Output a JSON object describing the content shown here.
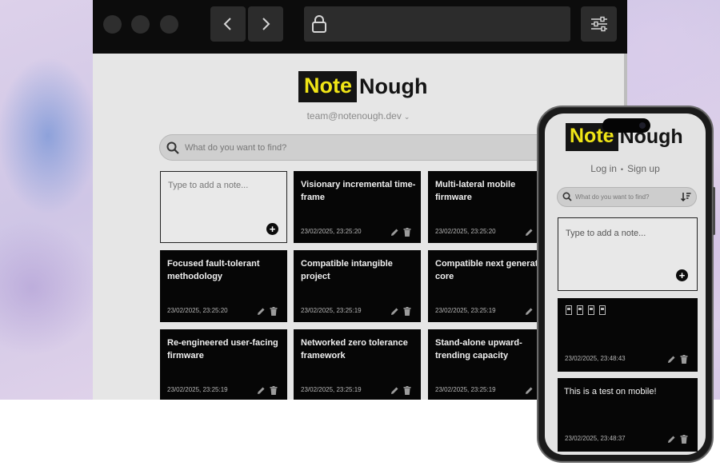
{
  "app": {
    "logo_note": "Note",
    "logo_nough": "Nough"
  },
  "desktop": {
    "account_email": "team@notenough.dev",
    "search_placeholder": "What do you want to find?",
    "new_note_placeholder": "Type to add a note...",
    "notes": [
      {
        "title": "Visionary incremental time-frame",
        "date": "23/02/2025, 23:25:20"
      },
      {
        "title": "Multi-lateral mobile firmware",
        "date": "23/02/2025, 23:25:20"
      },
      {
        "title": "Focused fault-tolerant methodology",
        "date": "23/02/2025, 23:25:20"
      },
      {
        "title": "Compatible intangible project",
        "date": "23/02/2025, 23:25:19"
      },
      {
        "title": "Compatible next generati core",
        "date": "23/02/2025, 23:25:19"
      },
      {
        "title": "Re-engineered user-facing firmware",
        "date": "23/02/2025, 23:25:19"
      },
      {
        "title": "Networked zero tolerance framework",
        "date": "23/02/2025, 23:25:19"
      },
      {
        "title": "Stand-alone upward-trending capacity",
        "date": "23/02/2025, 23:25:19"
      }
    ]
  },
  "mobile": {
    "login_label": "Log in",
    "separator": "•",
    "signup_label": "Sign up",
    "search_placeholder": "What do you want to find?",
    "new_note_placeholder": "Type to add a note...",
    "notes": [
      {
        "title": "",
        "date": "23/02/2025, 23:48:43"
      },
      {
        "title": "This is a test on mobile!",
        "date": "23/02/2025, 23:48:37"
      }
    ]
  },
  "colors": {
    "brand_yellow": "#f0e516",
    "card_bg": "#060606",
    "page_bg": "#e6e6e6"
  },
  "icons": {
    "new_note": "plus-circle-icon",
    "edit": "pencil-icon",
    "delete": "trash-icon",
    "search": "search-icon",
    "sort": "sort-icon",
    "lock": "lock-icon",
    "settings": "sliders-icon"
  }
}
